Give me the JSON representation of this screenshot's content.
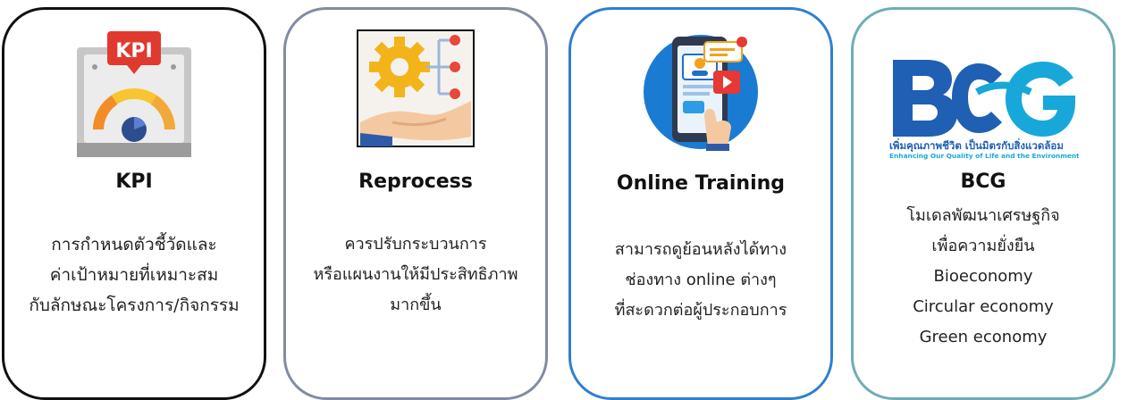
{
  "cards": [
    {
      "title": "KPI",
      "icon_text": "KPI",
      "lines": [
        "การกำหนดตัวชี้วัดและ",
        "ค่าเป้าหมายที่เหมาะสม",
        "กับลักษณะโครงการ/กิจกรรม"
      ]
    },
    {
      "title": "Reprocess",
      "lines": [
        "ควรปรับกระบวนการ",
        "หรือแผนงานให้มีประสิทธิภาพ",
        "มากขึ้น"
      ]
    },
    {
      "title": "Online Training",
      "lines": [
        "สามารถดูย้อนหลังได้ทาง",
        "ช่องทาง online ต่างๆ",
        "ที่สะดวกต่อผู้ประกอบการ"
      ]
    },
    {
      "title": "BCG",
      "logo_thai": "เพิ่มคุณภาพชีวิต เป็นมิตรกับสิ่งแวดล้อม",
      "logo_en": "Enhancing Our Quality of Life and the Environment",
      "lines": [
        "โมเดลพัฒนาเศรษฐกิจ",
        "เพื่อความยั่งยืน",
        "Bioeconomy",
        "Circular economy",
        "Green economy"
      ]
    }
  ],
  "colors": {
    "card1_border": "#111111",
    "card2_border": "#7f8ca3",
    "card3_border": "#2f7fd1",
    "card4_border": "#6fadb6",
    "bcg_blue": "#1f5fb4",
    "bcg_cyan": "#17a8d9"
  },
  "icons": [
    "kpi-gauge-icon",
    "gear-hand-process-icon",
    "phone-online-training-icon",
    "bcg-logo"
  ]
}
